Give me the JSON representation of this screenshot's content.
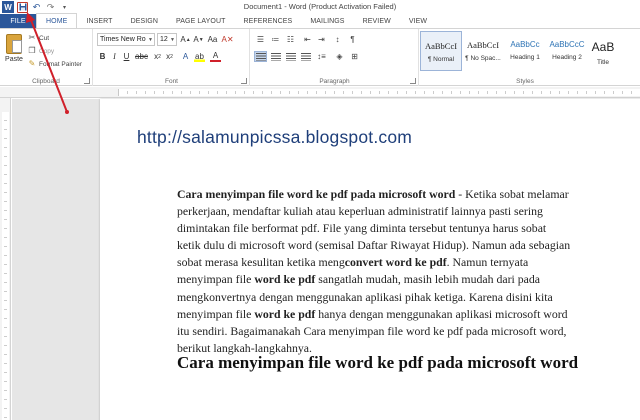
{
  "titlebar": {
    "title": "Document1 - Word (Product Activation Failed)",
    "logo_letter": "W",
    "quick_access": [
      "save-icon",
      "undo-icon",
      "redo-icon",
      "customize-icon"
    ]
  },
  "tabs": [
    {
      "label": "FILE"
    },
    {
      "label": "HOME"
    },
    {
      "label": "INSERT"
    },
    {
      "label": "DESIGN"
    },
    {
      "label": "PAGE LAYOUT"
    },
    {
      "label": "REFERENCES"
    },
    {
      "label": "MAILINGS"
    },
    {
      "label": "REVIEW"
    },
    {
      "label": "VIEW"
    }
  ],
  "clipboard": {
    "group_label": "Clipboard",
    "paste_label": "Paste",
    "cut_label": "Cut",
    "copy_label": "Copy",
    "format_painter_label": "Format Painter"
  },
  "font": {
    "group_label": "Font",
    "font_name": "Times New Ro",
    "font_size": "12"
  },
  "paragraph": {
    "group_label": "Paragraph"
  },
  "styles": {
    "group_label": "Styles",
    "items": [
      {
        "sample": "AaBbCcI",
        "name": "¶ Normal"
      },
      {
        "sample": "AaBbCcI",
        "name": "¶ No Spac..."
      },
      {
        "sample": "AaBbCc",
        "name": "Heading 1"
      },
      {
        "sample": "AaBbCcC",
        "name": "Heading 2"
      },
      {
        "sample": "AaB",
        "name": "Title"
      }
    ]
  },
  "document": {
    "url": "http://salamunpicssa.blogspot.com",
    "line1_bold": "Cara menyimpan file word ke pdf pada microsoft word",
    "line1_rest": " - Ketika sobat melamar",
    "line2": "perkerjaan, mendaftar kuliah atau keperluan administratif lainnya pasti sering",
    "line3": "dimintakan file berformat pdf. File yang diminta tersebut tentunya harus sobat",
    "line4": "ketik dulu di microsoft word (semisal Daftar Riwayat Hidup). Namun ada sebagian",
    "line5_pre": "sobat merasa kesulitan ketika meng",
    "line5_bold": "convert word ke pdf",
    "line5_post": ". Namun ternyata",
    "line6_pre": "menyimpan file ",
    "line6_bold": "word ke pdf",
    "line6_post": " sangatlah mudah, masih lebih mudah dari pada",
    "line7": "mengkonvertnya dengan menggunakan aplikasi pihak ketiga. Karena disini kita",
    "line8_pre": "menyimpan file ",
    "line8_bold": "word ke pdf",
    "line8_post": " hanya dengan menggunakan aplikasi microsoft word",
    "line9": "itu sendiri. Bagaimanakah Cara menyimpan file word ke pdf pada microsoft word,",
    "line10": "berikut langkah-langkahnya.",
    "heading": "Cara menyimpan file word ke pdf pada microsoft word"
  },
  "colors": {
    "accent": "#2b579a",
    "url_color": "#1f3f7a",
    "annotation_arrow": "#d0202a"
  }
}
